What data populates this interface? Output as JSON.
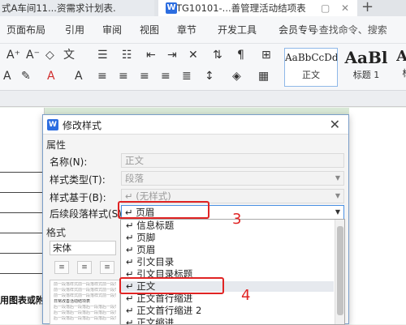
{
  "tabs": [
    {
      "label": "式A车间11...资需求计划表."
    },
    {
      "label": "TG10101-...善管理活动结项表"
    }
  ],
  "menu": [
    "页面布局",
    "引用",
    "审阅",
    "视图",
    "章节",
    "开发工具",
    "会员专号",
    "查找命令、搜索"
  ],
  "style_gallery": [
    {
      "preview": "AaBbCcDd",
      "name": "正文"
    },
    {
      "preview": "AaBl",
      "name": "标题 1"
    },
    {
      "preview": "Aa",
      "name": "标"
    }
  ],
  "dialog": {
    "title": "修改样式",
    "section_properties": "属性",
    "name_label": "名称(N):",
    "name_value": "正文",
    "type_label": "样式类型(T):",
    "type_value": "段落",
    "based_label": "样式基于(B):",
    "based_value": "↵ (无样式)",
    "next_label": "后续段落样式(S):",
    "next_value": "↵ 页眉",
    "section_format": "格式",
    "font_value": "宋体",
    "dropdown": [
      "↵ 信息标题",
      "↵ 页脚",
      "↵ 页眉",
      "↵ 引文目录",
      "↵ 引文目录标题",
      "↵ 正文",
      "↵ 正文首行缩进",
      "↵ 正文首行缩进 2",
      "↵ 正文缩进"
    ],
    "preview_before": "前一段落样式前一段落样式前一段落样式前一段落",
    "preview_main": "日常改善活动结项表",
    "preview_after": "后一段落后一段落后一段落后一段落"
  },
  "annotations": [
    "3",
    "4"
  ],
  "doc_text": "用图表或附"
}
